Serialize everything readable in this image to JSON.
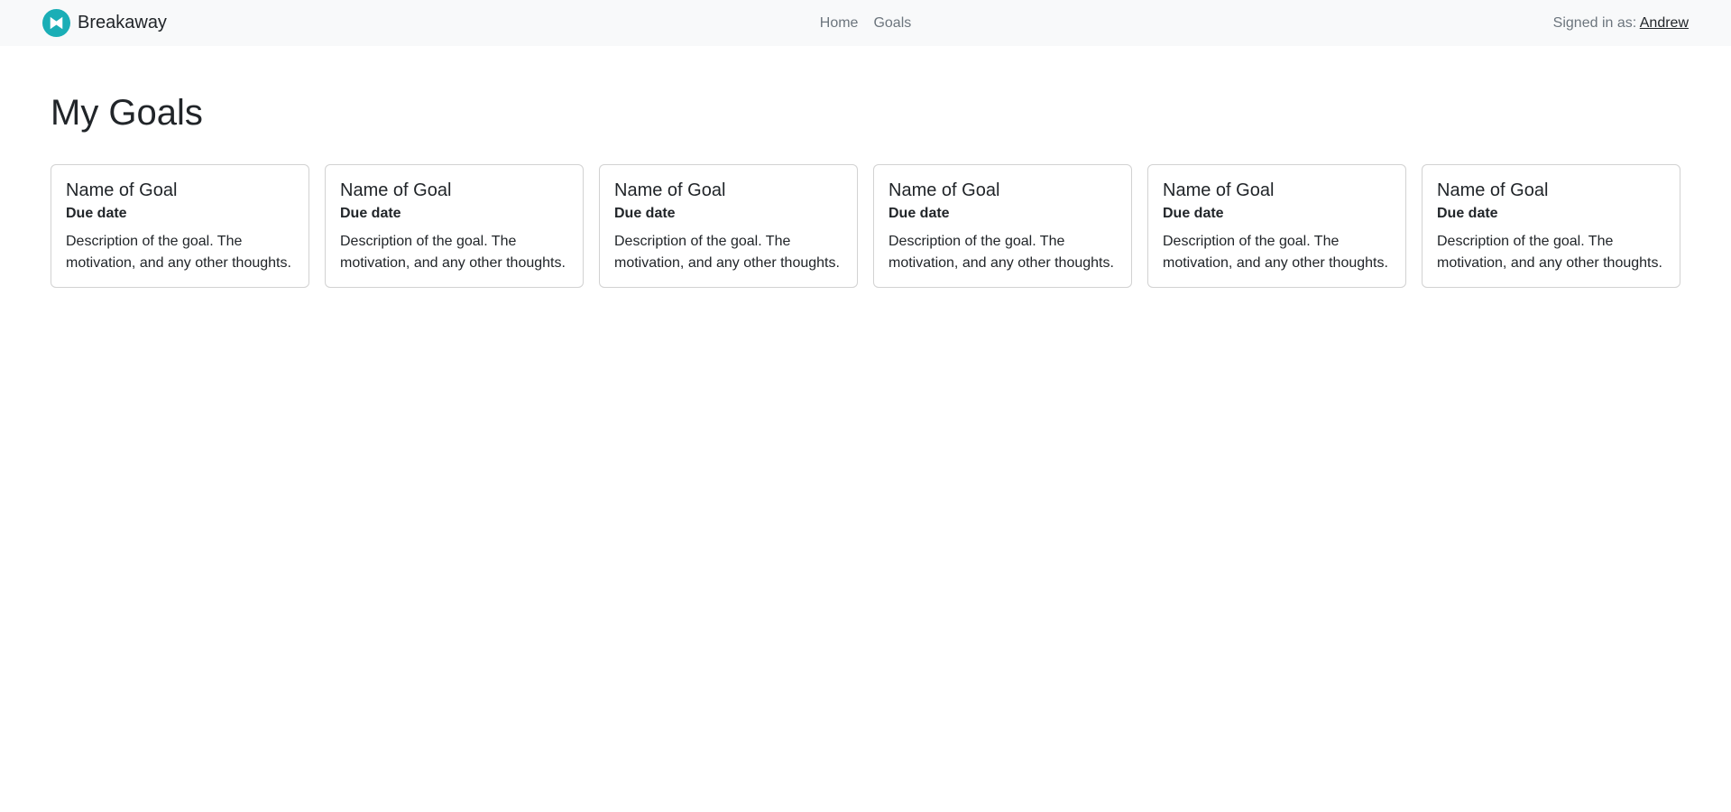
{
  "navbar": {
    "brand": "Breakaway",
    "brand_color": "#1aaeb6",
    "links": [
      "Home",
      "Goals"
    ],
    "signed_in_prefix": "Signed in as: ",
    "user_name": "Andrew"
  },
  "main": {
    "title": "My Goals",
    "cards": [
      {
        "title": "Name of Goal",
        "subtitle": "Due date",
        "text": "Description of the goal. The motivation, and any other thoughts."
      },
      {
        "title": "Name of Goal",
        "subtitle": "Due date",
        "text": "Description of the goal. The motivation, and any other thoughts."
      },
      {
        "title": "Name of Goal",
        "subtitle": "Due date",
        "text": "Description of the goal. The motivation, and any other thoughts."
      },
      {
        "title": "Name of Goal",
        "subtitle": "Due date",
        "text": "Description of the goal. The motivation, and any other thoughts."
      },
      {
        "title": "Name of Goal",
        "subtitle": "Due date",
        "text": "Description of the goal. The motivation, and any other thoughts."
      },
      {
        "title": "Name of Goal",
        "subtitle": "Due date",
        "text": "Description of the goal. The motivation, and any other thoughts."
      }
    ]
  }
}
